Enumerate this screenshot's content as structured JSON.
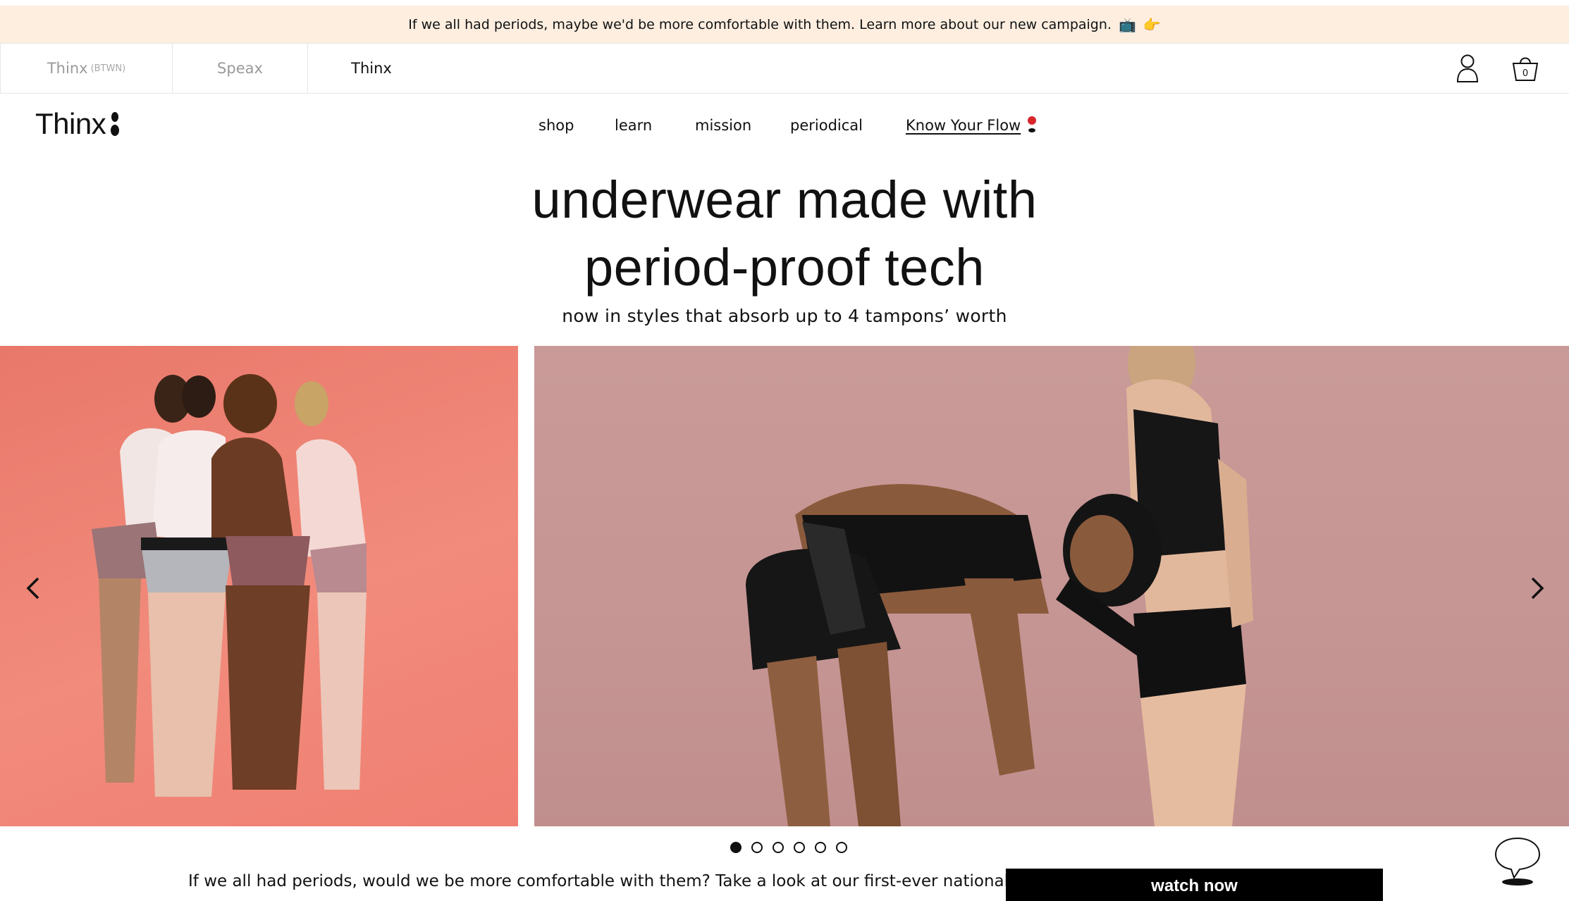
{
  "announcement": {
    "text": "If we all had periods, maybe we'd be more comfortable with them. Learn more about our new campaign.",
    "emojis": [
      "tv-icon",
      "pointing-hand-icon"
    ]
  },
  "brands": {
    "items": [
      {
        "label": "Thinx",
        "suffix": "(BTWN)"
      },
      {
        "label": "Speax",
        "suffix": ""
      },
      {
        "label": "Thinx",
        "suffix": ""
      }
    ],
    "cart_count": "0"
  },
  "logo": {
    "text": "Thinx"
  },
  "nav": {
    "items": [
      "shop",
      "learn",
      "mission",
      "periodical",
      "Know Your Flow"
    ]
  },
  "hero": {
    "title_line1": "underwear made with",
    "title_line2": "period-proof tech",
    "subtitle": "now in styles that absorb up to 4 tampons’ worth"
  },
  "carousel": {
    "slide_count": 6,
    "active_index": 0,
    "left_bg": "#ef7f72",
    "right_bg": "#c59593"
  },
  "promo": {
    "text": "If we all had periods, would we be more comfortable with them? Take a look at our first-ever national",
    "button_label": "watch now"
  }
}
